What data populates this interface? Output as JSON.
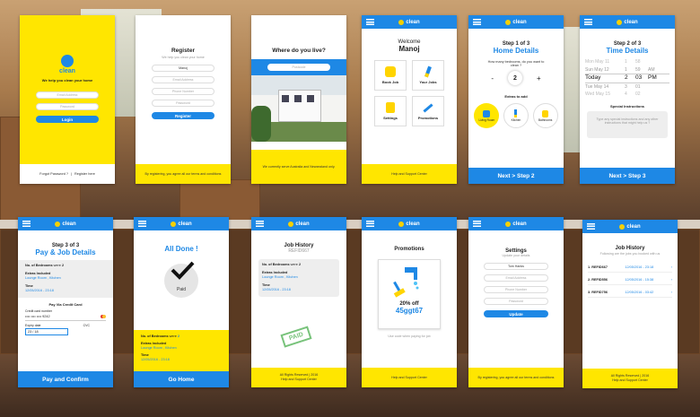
{
  "brand": "clean",
  "welcome_screen": {
    "tagline": "We help you clean your home",
    "email_placeholder": "Email Address",
    "password_placeholder": "Password",
    "login": "Login",
    "forgot": "Forgot Password ?",
    "separator": "|",
    "register_here": "Register here"
  },
  "register_screen": {
    "title": "Register",
    "subtitle": "We help you clean your home",
    "name_value": "Manoj",
    "email_placeholder": "Email Address",
    "phone_placeholder": "Phone Number",
    "password_placeholder": "Password",
    "register_button": "Register",
    "terms": "By registering, you agree all our terms and conditions"
  },
  "location_screen": {
    "title": "Where do you live?",
    "postcode_placeholder": "Postcode",
    "note": "We currently serve Australia and Newzealand only."
  },
  "home_screen": {
    "welcome": "Welcome",
    "name": "Manoj",
    "tiles": [
      "Book Job",
      "Your Jobs",
      "Settings",
      "Promotions"
    ],
    "footer": "Help and Support Center"
  },
  "step1_screen": {
    "step": "Step 1 of 3",
    "heading": "Home Details",
    "question": "How many bedrooms, do you want to clean ?",
    "count": "2",
    "minus": "-",
    "plus": "+",
    "extras_label": "Extras to add",
    "extras": [
      "Living Room",
      "Kitchen",
      "Bathrooms"
    ],
    "next": "Next > Step 2"
  },
  "step2_screen": {
    "step": "Step 2 of 3",
    "heading": "Time Details",
    "picker_rows": [
      [
        "Mon May 11",
        "1",
        "58",
        ""
      ],
      [
        "Sun May 12",
        "1",
        "59",
        "AM"
      ],
      [
        "Today",
        "2",
        "03",
        "PM"
      ],
      [
        "Tue May 14",
        "3",
        "01",
        ""
      ],
      [
        "Wed May 15",
        "4",
        "02",
        ""
      ]
    ],
    "special_label": "Special Instructions",
    "special_placeholder": "Type any special instructions and any other instructions that might help us ?",
    "next": "Next > Step 3"
  },
  "step3_screen": {
    "step": "Step 3 of 3",
    "heading": "Pay & Job Details",
    "bedrooms_label": "No. of Bedrooms",
    "were": "were",
    "bedrooms": "2",
    "extras_label": "Extras Included",
    "extras": "Lounge Room , Kitchen",
    "time_label": "Time",
    "time": "12/05/2016 - 23:18",
    "pay_title": "Pay Via Credit Card",
    "card_label": "Credit card number",
    "card_masked": "•••• •••• •••• 9242",
    "expiry_label": "Expiry date",
    "cvc_label": "CVC",
    "expiry": "23 / 18",
    "pay_button": "Pay and Confirm"
  },
  "done_screen": {
    "title": "All Done !",
    "badge": "Paid",
    "bedrooms_label": "No. of Bedrooms",
    "were": "were",
    "bedrooms": "2",
    "extras_label": "Extras Included",
    "extras": "Lounge Room , Kitchen",
    "time_label": "Time",
    "time": "12/05/2016 - 23:18",
    "go_home": "Go Home"
  },
  "job_detail_screen": {
    "title": "Job History",
    "ref": "REFID667",
    "bedrooms_label": "No. of Bedrooms",
    "were": "were",
    "bedrooms": "2",
    "extras_label": "Extras Included",
    "extras": "Lounge Room , Kitchen",
    "time_label": "Time",
    "time": "12/05/2016 - 23:18",
    "stamp": "PAID",
    "footer1": "All Rights Reserved | 2016",
    "footer2": "Help and Support Center"
  },
  "promotions_screen": {
    "title": "Promotions",
    "discount": "20% off",
    "code": "45ggt67",
    "hint": "Use code when paying for job",
    "footer": "Help and Support Center"
  },
  "settings_screen": {
    "title": "Settings",
    "subtitle": "Update your details",
    "name_value": "Tom Hanks",
    "email_placeholder": "Email Address",
    "phone_placeholder": "Phone Number",
    "password_placeholder": "Password",
    "update": "Update",
    "terms": "By registering, you agree all our terms and conditions"
  },
  "history_screen": {
    "title": "Job History",
    "subtitle": "Following are the jobs you booked with us",
    "rows": [
      {
        "n": "1.",
        "ref": "REFID667",
        "date": "12/05/2016 - 23:18"
      },
      {
        "n": "2.",
        "ref": "REFID556",
        "date": "12/05/2016 - 15:38"
      },
      {
        "n": "3.",
        "ref": "REFID756",
        "date": "12/05/2016 - 03:42"
      }
    ],
    "footer1": "All Rights Reserved | 2016",
    "footer2": "Help and Support Center"
  },
  "colors": {
    "blue": "#1e88e5",
    "yellow": "#ffe600"
  }
}
